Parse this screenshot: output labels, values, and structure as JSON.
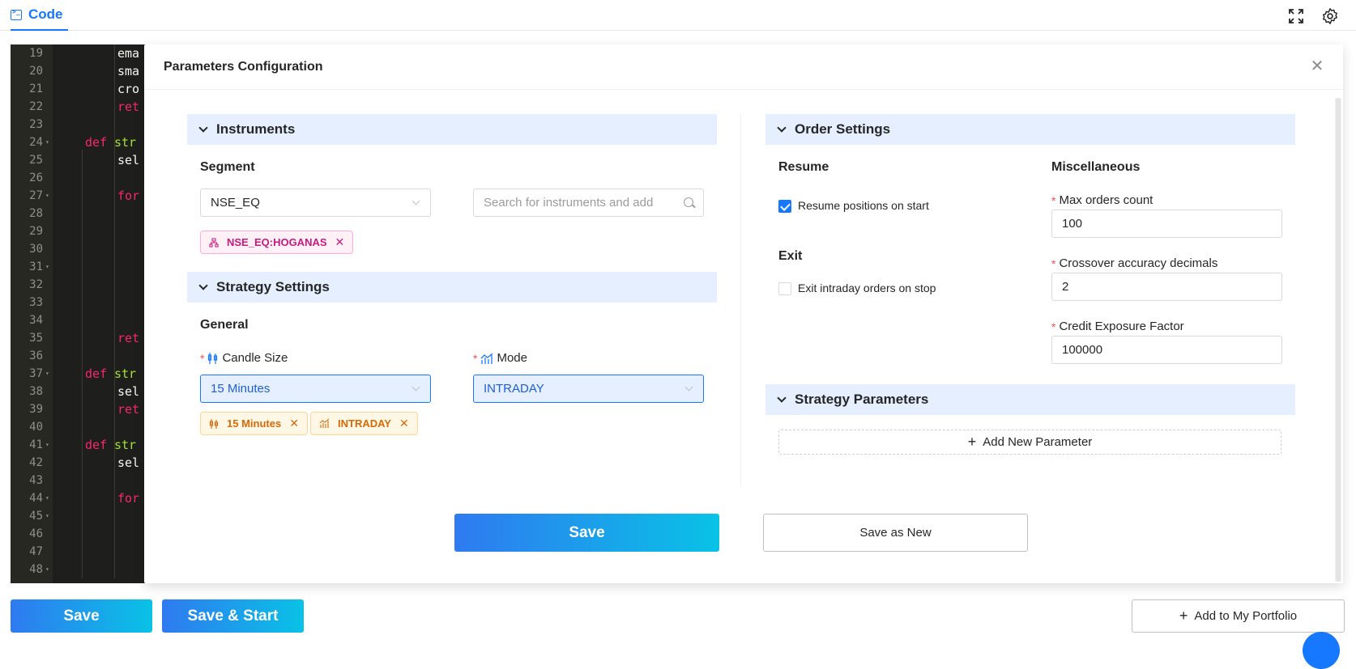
{
  "tab": {
    "label": "Code"
  },
  "editor": {
    "lines": [
      {
        "n": "19",
        "fold": false,
        "tokens": [
          {
            "t": "ema",
            "c": "tx",
            "indent": 2
          }
        ]
      },
      {
        "n": "20",
        "fold": false,
        "tokens": [
          {
            "t": "sma",
            "c": "tx",
            "indent": 2
          }
        ]
      },
      {
        "n": "21",
        "fold": false,
        "tokens": [
          {
            "t": "cro",
            "c": "tx",
            "indent": 2
          }
        ]
      },
      {
        "n": "22",
        "fold": false,
        "tokens": [
          {
            "t": "ret",
            "c": "kw",
            "indent": 2
          }
        ]
      },
      {
        "n": "23",
        "fold": false,
        "tokens": []
      },
      {
        "n": "24",
        "fold": true,
        "tokens": [
          {
            "t": "def",
            "c": "kw",
            "indent": 1
          },
          {
            "t": "str",
            "c": "fn",
            "indent": 1.9
          }
        ]
      },
      {
        "n": "25",
        "fold": false,
        "tokens": [
          {
            "t": "sel",
            "c": "tx",
            "indent": 2
          }
        ]
      },
      {
        "n": "26",
        "fold": false,
        "tokens": []
      },
      {
        "n": "27",
        "fold": true,
        "tokens": [
          {
            "t": "for",
            "c": "kw",
            "indent": 2
          }
        ]
      },
      {
        "n": "28",
        "fold": false,
        "tokens": []
      },
      {
        "n": "29",
        "fold": false,
        "tokens": []
      },
      {
        "n": "30",
        "fold": false,
        "tokens": []
      },
      {
        "n": "31",
        "fold": true,
        "tokens": []
      },
      {
        "n": "32",
        "fold": false,
        "tokens": []
      },
      {
        "n": "33",
        "fold": false,
        "tokens": []
      },
      {
        "n": "34",
        "fold": false,
        "tokens": []
      },
      {
        "n": "35",
        "fold": false,
        "tokens": [
          {
            "t": "ret",
            "c": "kw",
            "indent": 2
          }
        ]
      },
      {
        "n": "36",
        "fold": false,
        "tokens": []
      },
      {
        "n": "37",
        "fold": true,
        "tokens": [
          {
            "t": "def",
            "c": "kw",
            "indent": 1
          },
          {
            "t": "str",
            "c": "fn",
            "indent": 1.9
          }
        ]
      },
      {
        "n": "38",
        "fold": false,
        "tokens": [
          {
            "t": "sel",
            "c": "tx",
            "indent": 2
          }
        ]
      },
      {
        "n": "39",
        "fold": false,
        "tokens": [
          {
            "t": "ret",
            "c": "kw",
            "indent": 2
          }
        ]
      },
      {
        "n": "40",
        "fold": false,
        "tokens": []
      },
      {
        "n": "41",
        "fold": true,
        "tokens": [
          {
            "t": "def",
            "c": "kw",
            "indent": 1
          },
          {
            "t": "str",
            "c": "fn",
            "indent": 1.9
          }
        ]
      },
      {
        "n": "42",
        "fold": false,
        "tokens": [
          {
            "t": "sel",
            "c": "tx",
            "indent": 2
          }
        ]
      },
      {
        "n": "43",
        "fold": false,
        "tokens": []
      },
      {
        "n": "44",
        "fold": true,
        "tokens": [
          {
            "t": "for",
            "c": "kw",
            "indent": 2
          }
        ]
      },
      {
        "n": "45",
        "fold": true,
        "tokens": []
      },
      {
        "n": "46",
        "fold": false,
        "tokens": []
      },
      {
        "n": "47",
        "fold": false,
        "tokens": []
      },
      {
        "n": "48",
        "fold": true,
        "tokens": []
      }
    ]
  },
  "modal": {
    "title": "Parameters Configuration",
    "instruments": {
      "header": "Instruments",
      "segment_label": "Segment",
      "segment_value": "NSE_EQ",
      "search_placeholder": "Search for instruments and add",
      "tag": "NSE_EQ:HOGANAS"
    },
    "strategy_settings": {
      "header": "Strategy Settings",
      "general_label": "General",
      "candle_label": "Candle Size",
      "candle_value": "15 Minutes",
      "mode_label": "Mode",
      "mode_value": "INTRADAY",
      "tags": [
        "15 Minutes",
        "INTRADAY"
      ]
    },
    "order_settings": {
      "header": "Order Settings",
      "resume_label": "Resume",
      "resume_checkbox": "Resume positions on start",
      "resume_checked": true,
      "exit_label": "Exit",
      "exit_checkbox": "Exit intraday orders on stop",
      "exit_checked": false,
      "misc_label": "Miscellaneous",
      "max_orders_label": "Max orders count",
      "max_orders_value": "100",
      "crossover_label": "Crossover accuracy decimals",
      "crossover_value": "2",
      "credit_label": "Credit Exposure Factor",
      "credit_value": "100000"
    },
    "strategy_parameters": {
      "header": "Strategy Parameters",
      "add_button": "Add New Parameter"
    },
    "save_button": "Save",
    "save_as_new_button": "Save as New"
  },
  "footer": {
    "save": "Save",
    "save_start": "Save & Start",
    "add_portfolio": "Add to My Portfolio"
  },
  "colors": {
    "accent": "#1677ff",
    "section_bg": "#e6efff",
    "gradient_start": "#2f7af0",
    "gradient_end": "#09c2e6"
  }
}
